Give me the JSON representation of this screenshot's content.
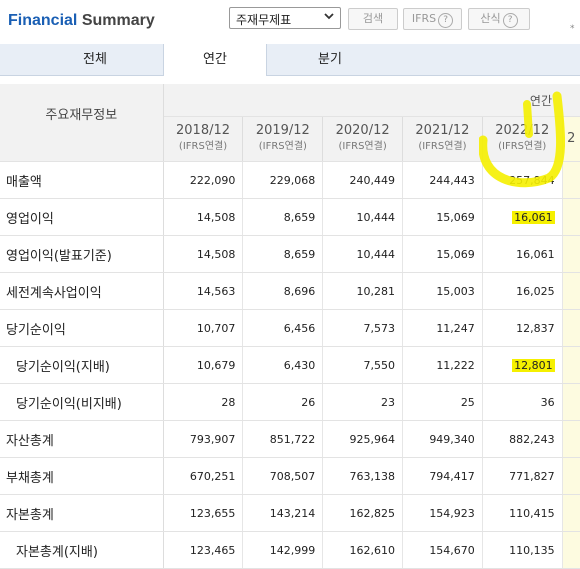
{
  "header": {
    "title_part1": "Financial",
    "title_part2": "Summary",
    "select_value": "주재무제표",
    "search_label": "검색",
    "ifrs_label": "IFRS",
    "calc_label": "산식",
    "help_glyph": "?",
    "note_glyph": "*"
  },
  "tabs": [
    {
      "label": "전체",
      "active": false
    },
    {
      "label": "연간",
      "active": true
    },
    {
      "label": "분기",
      "active": false
    }
  ],
  "table": {
    "corner_label": "주요재무정보",
    "group_label": "연간",
    "years": [
      {
        "year": "2018/12",
        "basis": "(IFRS연결)"
      },
      {
        "year": "2019/12",
        "basis": "(IFRS연결)"
      },
      {
        "year": "2020/12",
        "basis": "(IFRS연결)"
      },
      {
        "year": "2021/12",
        "basis": "(IFRS연결)"
      },
      {
        "year": "2022/12",
        "basis": "(IFRS연결)"
      }
    ],
    "next_col_glyph": "2",
    "rows": [
      {
        "label": "매출액",
        "indent": false,
        "values": [
          "222,090",
          "229,068",
          "240,449",
          "244,443",
          "257,844"
        ]
      },
      {
        "label": "영업이익",
        "indent": false,
        "values": [
          "14,508",
          "8,659",
          "10,444",
          "15,069",
          "16,061"
        ]
      },
      {
        "label": "영업이익(발표기준)",
        "indent": false,
        "values": [
          "14,508",
          "8,659",
          "10,444",
          "15,069",
          "16,061"
        ]
      },
      {
        "label": "세전계속사업이익",
        "indent": false,
        "values": [
          "14,563",
          "8,696",
          "10,281",
          "15,003",
          "16,025"
        ]
      },
      {
        "label": "당기순이익",
        "indent": false,
        "values": [
          "10,707",
          "6,456",
          "7,573",
          "11,247",
          "12,837"
        ]
      },
      {
        "label": "당기순이익(지배)",
        "indent": true,
        "values": [
          "10,679",
          "6,430",
          "7,550",
          "11,222",
          "12,801"
        ]
      },
      {
        "label": "당기순이익(비지배)",
        "indent": true,
        "values": [
          "28",
          "26",
          "23",
          "25",
          "36"
        ]
      },
      {
        "label": "자산총계",
        "indent": false,
        "values": [
          "793,907",
          "851,722",
          "925,964",
          "949,340",
          "882,243"
        ]
      },
      {
        "label": "부채총계",
        "indent": false,
        "values": [
          "670,251",
          "708,507",
          "763,138",
          "794,417",
          "771,827"
        ]
      },
      {
        "label": "자본총계",
        "indent": false,
        "values": [
          "123,655",
          "143,214",
          "162,825",
          "154,923",
          "110,415"
        ]
      },
      {
        "label": "자본총계(지배)",
        "indent": true,
        "values": [
          "123,465",
          "142,999",
          "162,610",
          "154,670",
          "110,135"
        ]
      }
    ]
  },
  "highlight_color": "#f5f000"
}
